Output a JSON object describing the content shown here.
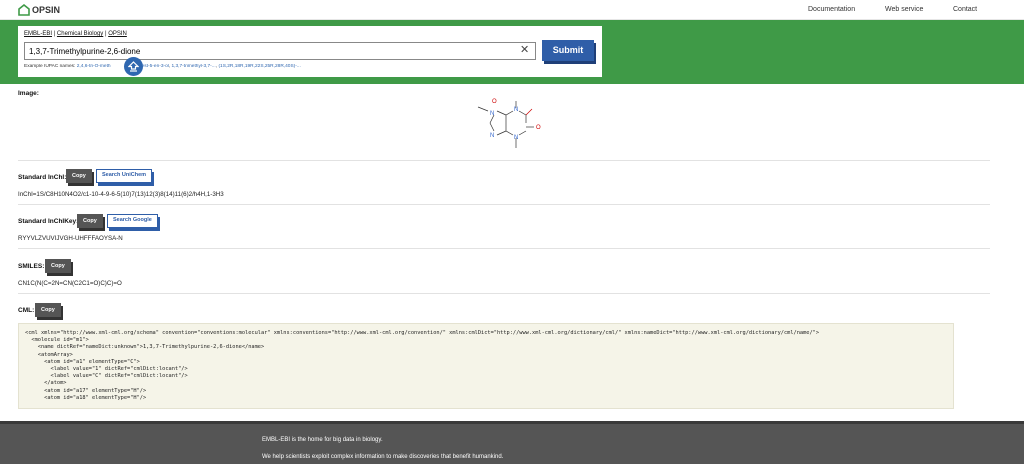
{
  "header": {
    "logo_text": "OPSIN",
    "nav": [
      "Documentation",
      "Web service",
      "Contact"
    ]
  },
  "search": {
    "breadcrumb": [
      "EMBL-EBI",
      "Chemical Biology",
      "OPSIN"
    ],
    "breadcrumb_sep": "|",
    "input_value": "1,3,7-Trimethylpurine-2,6-dione",
    "clear_icon": "close-icon",
    "submit_label": "Submit",
    "examples_label": "Example IUPAC names:",
    "examples": [
      "2,4,6-tri-O-meth",
      "8-cholest-5-en-3-ol",
      "1,3,7-trimethyl-3,7-...",
      "(1S,2R,18R,19R,22S,25R,28R,40S)-..."
    ],
    "examples_sep": ", "
  },
  "image": {
    "label": "Image:",
    "atoms": {
      "o1": "O",
      "n1": "N",
      "o2": "O",
      "n2": "N",
      "n3": "N",
      "n4": "N"
    }
  },
  "inchi": {
    "label": "Standard InChI:",
    "copy_label": "Copy",
    "search_label": "Search UniChem",
    "value": "InChI=1S/C8H10N4O2/c1-10-4-9-6-5(10)7(13)12(3)8(14)11(6)2/h4H,1-3H3"
  },
  "inchikey": {
    "label": "Standard InChIKey:",
    "copy_label": "Copy",
    "search_label": "Search Google",
    "value": "RYYVLZVUVIJVGH-UHFFFAOYSA-N"
  },
  "smiles": {
    "label": "SMILES:",
    "copy_label": "Copy",
    "value": "CN1C(N(C=2N=CN(C2C1=O)C)C)=O"
  },
  "cml": {
    "label": "CML:",
    "copy_label": "Copy",
    "lines": [
      "<cml xmlns=\"http://www.xml-cml.org/schema\" convention=\"conventions:molecular\" xmlns:conventions=\"http://www.xml-cml.org/convention/\" xmlns:cmlDict=\"http://www.xml-cml.org/dictionary/cml/\" xmlns:nameDict=\"http://www.xml-cml.org/dictionary/cml/name/\">",
      "  <molecule id=\"m1\">",
      "    <name dictRef=\"nameDict:unknown\">1,3,7-Trimethylpurine-2,6-dione</name>",
      "    <atomArray>",
      "      <atom id=\"a1\" elementType=\"C\">",
      "        <label value=\"1\" dictRef=\"cmlDict:locant\"/>",
      "        <label value=\"C\" dictRef=\"cmlDict:locant\"/>",
      "      </atom>",
      "      <atom id=\"a17\" elementType=\"H\"/>",
      "      <atom id=\"a18\" elementType=\"H\"/>"
    ]
  },
  "footer": {
    "line1": "EMBL-EBI is the home for big data in biology.",
    "line2": "We help scientists exploit complex information to make discoveries that benefit humankind."
  },
  "colors": {
    "brand_green": "#3f9a47",
    "button_blue": "#2f5ea8",
    "footer_gray": "#555555"
  }
}
